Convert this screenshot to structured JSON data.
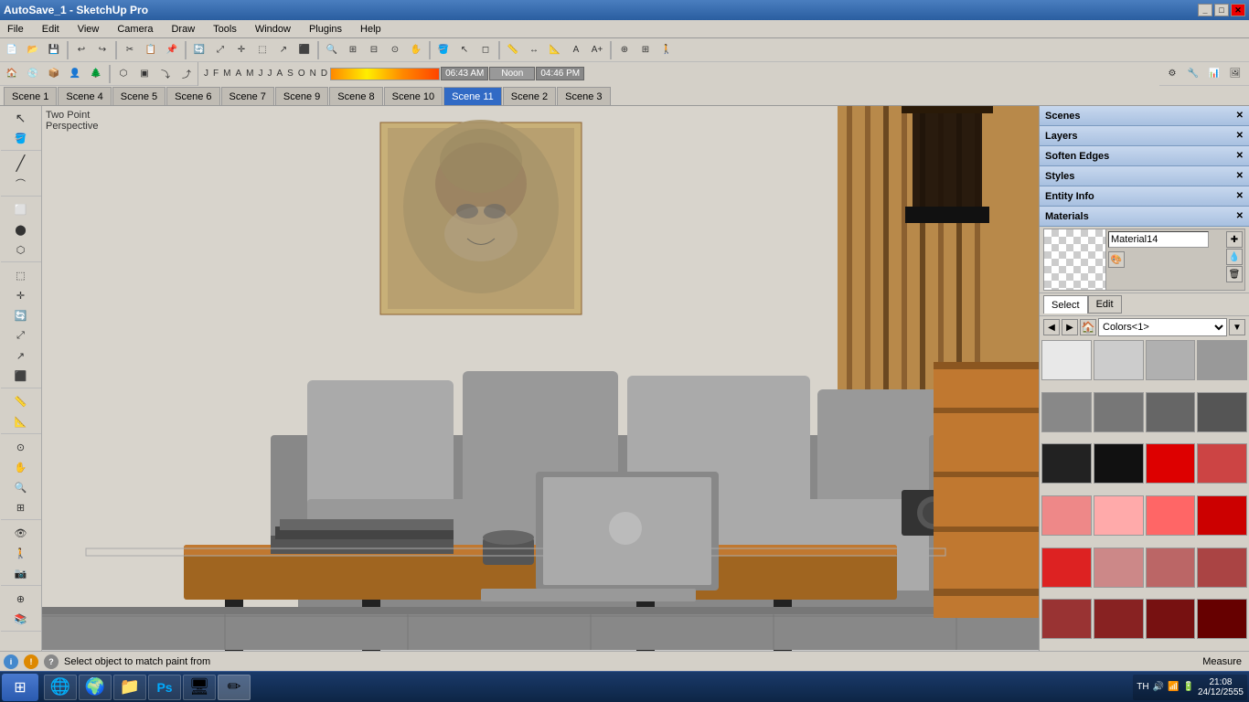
{
  "titleBar": {
    "title": "AutoSave_1 - SketchUp Pro",
    "controls": [
      "_",
      "□",
      "×"
    ]
  },
  "menuBar": {
    "items": [
      "File",
      "Edit",
      "View",
      "Camera",
      "Draw",
      "Tools",
      "Window",
      "Plugins",
      "Help"
    ]
  },
  "scenes": {
    "tabs": [
      "Scene 1",
      "Scene 4",
      "Scene 5",
      "Scene 6",
      "Scene 7",
      "Scene 9",
      "Scene 8",
      "Scene 10",
      "Scene 11",
      "Scene 2",
      "Scene 3"
    ],
    "active": "Scene 11"
  },
  "viewport": {
    "label_line1": "Two Point",
    "label_line2": "Perspective"
  },
  "timeline": {
    "months": [
      "J",
      "F",
      "M",
      "A",
      "M",
      "J",
      "J",
      "A",
      "S",
      "O",
      "N",
      "D"
    ],
    "time1": "06:43 AM",
    "time2": "Noon",
    "time3": "04:46 PM"
  },
  "rightPanel": {
    "panels": [
      {
        "id": "scenes",
        "label": "Scenes"
      },
      {
        "id": "layers",
        "label": "Layers"
      },
      {
        "id": "softenEdges",
        "label": "Soften Edges"
      },
      {
        "id": "styles",
        "label": "Styles"
      },
      {
        "id": "entityInfo",
        "label": "Entity Info"
      }
    ],
    "materials": {
      "header": "Materials",
      "materialName": "Material14",
      "selectLabel": "Select",
      "editLabel": "Edit",
      "colorsDropdown": "Colors<1>",
      "swatches": [
        "#e8e8e8",
        "#cccccc",
        "#b0b0b0",
        "#999999",
        "#888888",
        "#777777",
        "#666666",
        "#555555",
        "#222222",
        "#111111",
        "#dd0000",
        "#cc4444",
        "#ee8888",
        "#ffaaaa",
        "#ff6666",
        "#cc0000",
        "#dd2222",
        "#cc8888",
        "#bb6666",
        "#aa4444",
        "#993333",
        "#882222",
        "#771111",
        "#660000"
      ]
    }
  },
  "statusBar": {
    "icons": [
      "i",
      "!",
      "○"
    ],
    "statusText": "Select object to match paint from",
    "measureText": "Measure"
  },
  "taskbar": {
    "startIcon": "⊞",
    "apps": [
      {
        "icon": "🌐",
        "label": ""
      },
      {
        "icon": "🌍",
        "label": ""
      },
      {
        "icon": "📁",
        "label": ""
      },
      {
        "icon": "Ps",
        "label": ""
      },
      {
        "icon": "🖥",
        "label": ""
      },
      {
        "icon": "✏",
        "label": ""
      }
    ],
    "tray": {
      "lang": "TH",
      "time": "21:08",
      "date": "24/12/2555"
    }
  }
}
